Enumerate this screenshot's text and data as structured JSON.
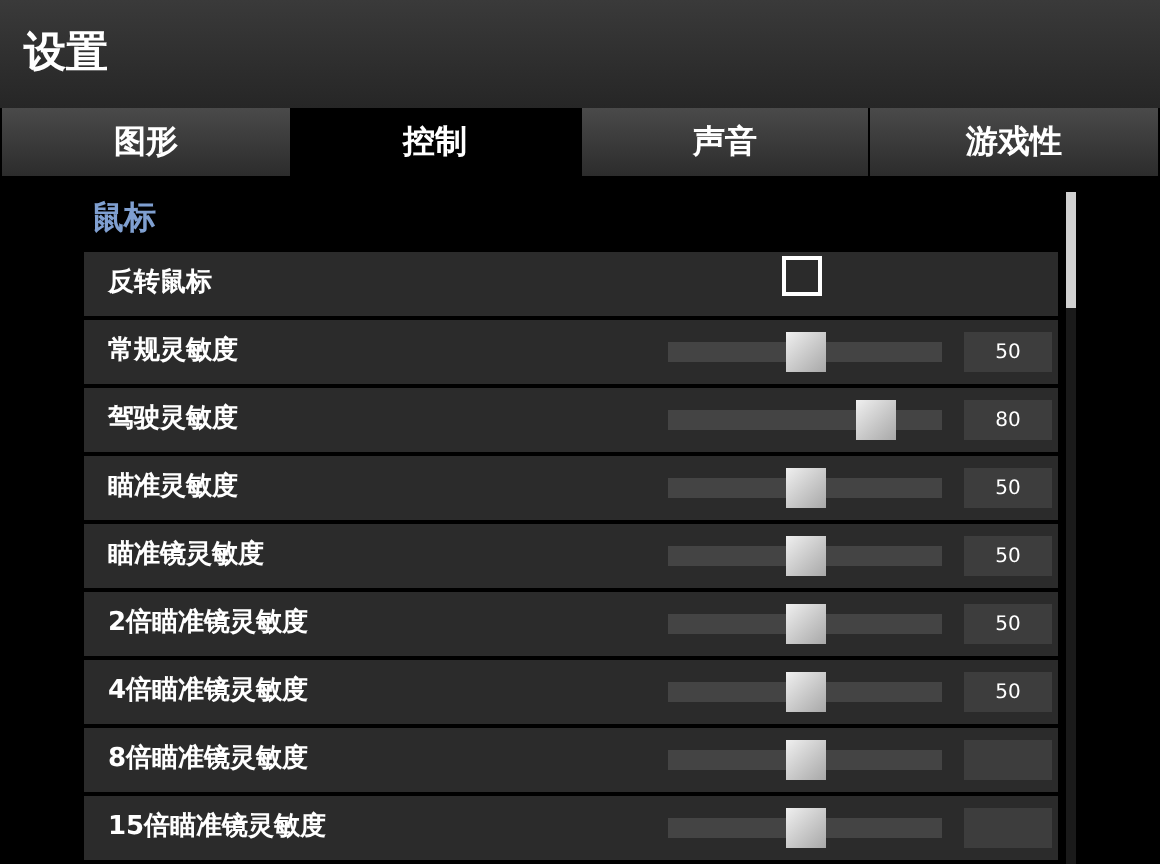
{
  "window": {
    "title": "设置"
  },
  "tabs": [
    {
      "label": "图形",
      "selected": false
    },
    {
      "label": "控制",
      "selected": true
    },
    {
      "label": "声音",
      "selected": false
    },
    {
      "label": "游戏性",
      "selected": false
    }
  ],
  "section": {
    "title": "鼠标"
  },
  "rows": [
    {
      "kind": "checkbox",
      "label": "反转鼠标",
      "checked": false
    },
    {
      "kind": "slider",
      "label": "常规灵敏度",
      "level": 0.5,
      "value": "50"
    },
    {
      "kind": "slider",
      "label": "驾驶灵敏度",
      "level": 0.8,
      "value": "80"
    },
    {
      "kind": "slider",
      "label": "瞄准灵敏度",
      "level": 0.5,
      "value": "50"
    },
    {
      "kind": "slider",
      "label": "瞄准镜灵敏度",
      "level": 0.5,
      "value": "50"
    },
    {
      "kind": "slider",
      "label": "2倍瞄准镜灵敏度",
      "level": 0.5,
      "value": "50"
    },
    {
      "kind": "slider",
      "label": "4倍瞄准镜灵敏度",
      "level": 0.5,
      "value": "50"
    },
    {
      "kind": "slider",
      "label": "8倍瞄准镜灵敏度",
      "level": 0.5
    },
    {
      "kind": "slider",
      "label": "15倍瞄准镜灵敏度",
      "level": 0.5
    }
  ]
}
